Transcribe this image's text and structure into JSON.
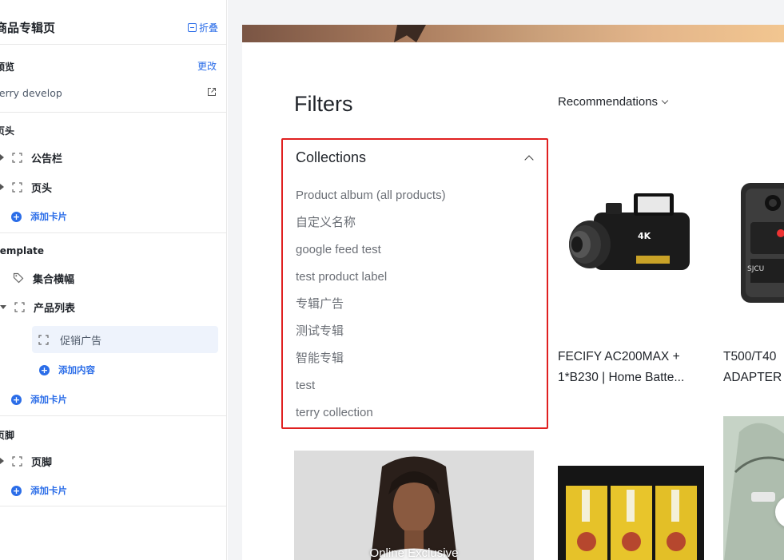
{
  "sidebar": {
    "title": "商品专辑页",
    "collapse_label": "折叠",
    "preview": {
      "label": "预览",
      "change_label": "更改",
      "theme_name": "terry develop"
    },
    "header_section": {
      "label": "页头",
      "items": [
        {
          "label": "公告栏"
        },
        {
          "label": "页头"
        }
      ],
      "add_card_label": "添加卡片"
    },
    "template_section": {
      "label": "template",
      "items": [
        {
          "label": "集合横幅"
        },
        {
          "label": "产品列表"
        }
      ],
      "sub_item": "促销广告",
      "add_content_label": "添加内容",
      "add_card_label": "添加卡片"
    },
    "footer_section": {
      "label": "页脚",
      "items": [
        {
          "label": "页脚"
        }
      ],
      "add_card_label": "添加卡片"
    }
  },
  "store": {
    "filters_title": "Filters",
    "sort_label": "Recommendations",
    "collections": {
      "title": "Collections",
      "items": [
        "Product album (all products)",
        "自定义名称",
        "google feed test",
        "test product label",
        "专辑广告",
        "测试专辑",
        "智能专辑",
        "test",
        "terry collection"
      ]
    },
    "products": [
      {
        "title_line1": "FECIFY AC200MAX +",
        "title_line2": "1*B230 | Home Batte..."
      },
      {
        "title_line1": "T500/T40",
        "title_line2": "ADAPTER"
      }
    ],
    "promo_text": "Online Exclusive"
  },
  "colors": {
    "accent": "#2b6de8",
    "highlight_border": "#e02020",
    "selected_bg": "#eef3fc"
  }
}
